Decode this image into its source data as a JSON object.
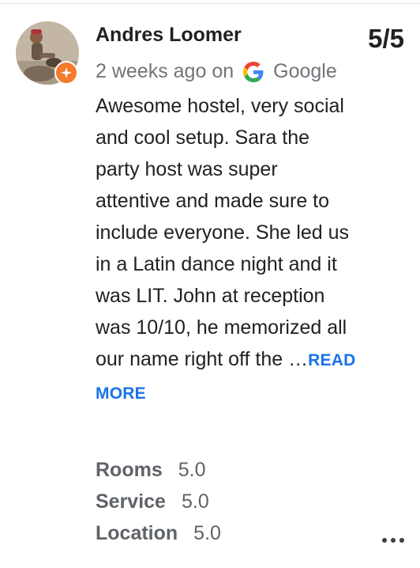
{
  "review": {
    "author": "Andres Loomer",
    "rating": "5/5",
    "time": "2 weeks ago on",
    "source": "Google",
    "text": "Awesome hostel, very social and cool setup. Sara the party host was super attentive and made sure to include everyone. She led us in a Latin dance night and it was LIT. John at reception was 10/10, he memorized all our name right off the",
    "ellipsis": "…",
    "read_more": "READ MORE"
  },
  "sub_ratings": [
    {
      "label": "Rooms",
      "value": "5.0"
    },
    {
      "label": "Service",
      "value": "5.0"
    },
    {
      "label": "Location",
      "value": "5.0"
    }
  ],
  "colors": {
    "accent": "#1a73e8",
    "badge": "#f37b2d",
    "muted": "#70757a"
  },
  "icons": {
    "source_icon": "google-g-icon",
    "badge_icon": "local-guide-star-icon",
    "more_icon": "more-horizontal-icon"
  }
}
